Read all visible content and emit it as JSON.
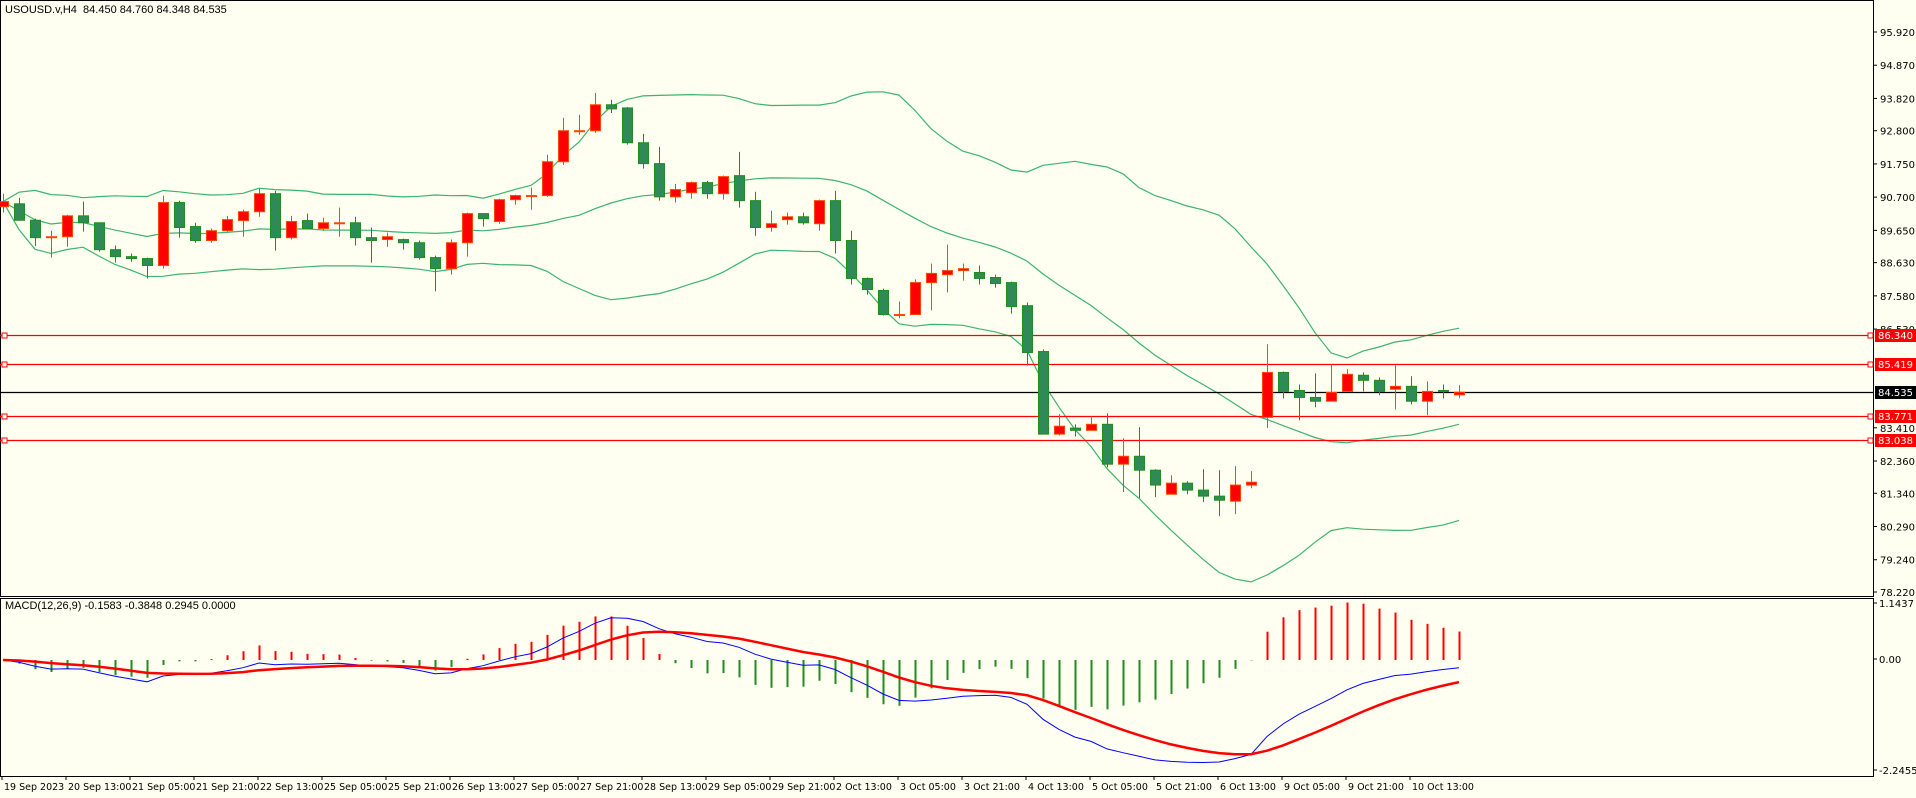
{
  "header": {
    "symbol_timeframe": "USOUSD.v,H4",
    "ohlc_readout": "84.450 84.760 84.348 84.535"
  },
  "indicator": {
    "label": "MACD(12,26,9)",
    "values_readout": "-0.1583 -0.3848 0.2945 0.0000"
  },
  "colors": {
    "background": "#FEFFF0",
    "bull_candle": "#FF0000",
    "bull_border": "#FF4500",
    "bear_candle": "#2E8B57",
    "bear_border": "#228B22",
    "bollinger": "#3CB371",
    "level_line": "#FF0000",
    "bid_line": "#000000",
    "macd_line": "#0000FF",
    "signal_line": "#FF0000"
  },
  "chart_data": {
    "type": "candlestick",
    "timeframe": "H4",
    "bollinger": {
      "period": 20,
      "deviation": 2
    },
    "macd": {
      "fast": 12,
      "slow": 26,
      "signal": 9,
      "ylim": [
        -2.2455,
        1.1437
      ],
      "tick_labels": [
        "1.1437",
        "0.00",
        "-2.2455"
      ]
    },
    "ylim": [
      78.22,
      95.92
    ],
    "y_tick_labels": [
      "95.920",
      "94.870",
      "93.820",
      "92.800",
      "91.750",
      "90.700",
      "89.650",
      "88.630",
      "87.580",
      "86.530",
      "83.410",
      "82.360",
      "81.340",
      "80.290",
      "79.240",
      "78.220"
    ],
    "x_tick_labels": [
      "19 Sep 2023",
      "20 Sep 13:00",
      "21 Sep 05:00",
      "21 Sep 21:00",
      "22 Sep 13:00",
      "25 Sep 05:00",
      "25 Sep 21:00",
      "26 Sep 13:00",
      "27 Sep 05:00",
      "27 Sep 21:00",
      "28 Sep 13:00",
      "29 Sep 05:00",
      "29 Sep 21:00",
      "2 Oct 13:00",
      "3 Oct 05:00",
      "3 Oct 21:00",
      "4 Oct 13:00",
      "5 Oct 05:00",
      "5 Oct 21:00",
      "6 Oct 13:00",
      "9 Oct 05:00",
      "9 Oct 21:00",
      "10 Oct 13:00"
    ],
    "levels": [
      {
        "price": 86.34,
        "label": "86.340",
        "kind": "level"
      },
      {
        "price": 85.419,
        "label": "85.419",
        "kind": "level"
      },
      {
        "price": 84.535,
        "label": "84.535",
        "kind": "bid"
      },
      {
        "price": 83.771,
        "label": "83.771",
        "kind": "level"
      },
      {
        "price": 83.038,
        "label": "83.038",
        "kind": "level"
      }
    ],
    "ohlc": [
      [
        90.4,
        90.81,
        90.21,
        90.56
      ],
      [
        90.49,
        90.68,
        89.97,
        89.97
      ],
      [
        89.97,
        90.02,
        89.16,
        89.42
      ],
      [
        89.45,
        89.64,
        88.79,
        89.45
      ],
      [
        89.45,
        90.14,
        89.13,
        90.11
      ],
      [
        90.11,
        90.56,
        89.61,
        89.89
      ],
      [
        89.89,
        89.89,
        88.98,
        89.04
      ],
      [
        89.04,
        89.17,
        88.63,
        88.82
      ],
      [
        88.82,
        88.92,
        88.66,
        88.76
      ],
      [
        88.76,
        88.79,
        88.13,
        88.54
      ],
      [
        88.54,
        90.75,
        88.44,
        90.53
      ],
      [
        90.53,
        90.59,
        89.42,
        89.74
      ],
      [
        89.77,
        89.89,
        89.26,
        89.33
      ],
      [
        89.33,
        89.71,
        89.26,
        89.64
      ],
      [
        89.64,
        90.11,
        89.61,
        89.99
      ],
      [
        89.96,
        90.3,
        89.45,
        90.24
      ],
      [
        90.24,
        90.97,
        90.08,
        90.81
      ],
      [
        90.81,
        90.9,
        89.01,
        89.42
      ],
      [
        89.42,
        90.11,
        89.36,
        89.93
      ],
      [
        89.96,
        90.18,
        89.71,
        89.71
      ],
      [
        89.71,
        90.05,
        89.64,
        89.89
      ],
      [
        89.89,
        90.37,
        89.45,
        89.89
      ],
      [
        89.89,
        90.08,
        89.17,
        89.42
      ],
      [
        89.42,
        89.74,
        88.63,
        89.33
      ],
      [
        89.36,
        89.58,
        89.13,
        89.45
      ],
      [
        89.36,
        89.39,
        89.04,
        89.26
      ],
      [
        89.26,
        89.33,
        88.73,
        88.79
      ],
      [
        88.79,
        88.85,
        87.72,
        88.44
      ],
      [
        88.44,
        89.36,
        88.25,
        89.26
      ],
      [
        89.26,
        90.21,
        88.82,
        90.18
      ],
      [
        90.18,
        90.18,
        89.77,
        90.02
      ],
      [
        89.93,
        90.65,
        89.86,
        90.62
      ],
      [
        90.62,
        90.78,
        90.46,
        90.75
      ],
      [
        90.75,
        91.0,
        90.3,
        90.75
      ],
      [
        90.75,
        92.04,
        90.71,
        91.82
      ],
      [
        91.82,
        93.21,
        91.72,
        92.8
      ],
      [
        92.8,
        93.3,
        92.67,
        92.8
      ],
      [
        92.8,
        93.99,
        92.73,
        93.62
      ],
      [
        93.62,
        93.78,
        93.36,
        93.49
      ],
      [
        93.52,
        93.55,
        92.36,
        92.42
      ],
      [
        92.42,
        92.7,
        91.6,
        91.76
      ],
      [
        91.76,
        92.29,
        90.59,
        90.71
      ],
      [
        90.71,
        91.12,
        90.53,
        90.94
      ],
      [
        90.84,
        91.19,
        90.65,
        91.16
      ],
      [
        91.16,
        91.22,
        90.65,
        90.81
      ],
      [
        90.81,
        91.38,
        90.62,
        91.35
      ],
      [
        91.38,
        92.13,
        90.37,
        90.59
      ],
      [
        90.59,
        90.87,
        89.48,
        89.74
      ],
      [
        89.74,
        90.27,
        89.61,
        89.86
      ],
      [
        89.99,
        90.21,
        89.83,
        90.08
      ],
      [
        90.08,
        90.21,
        89.83,
        89.89
      ],
      [
        89.86,
        90.62,
        89.64,
        90.59
      ],
      [
        90.59,
        90.9,
        88.92,
        89.33
      ],
      [
        89.33,
        89.64,
        87.94,
        88.13
      ],
      [
        88.13,
        88.16,
        87.62,
        87.78
      ],
      [
        87.75,
        87.81,
        86.96,
        86.99
      ],
      [
        86.99,
        87.4,
        86.87,
        86.99
      ],
      [
        86.99,
        88.1,
        86.99,
        88.0
      ],
      [
        88.0,
        88.6,
        87.12,
        88.29
      ],
      [
        88.25,
        89.2,
        87.69,
        88.38
      ],
      [
        88.38,
        88.6,
        88.06,
        88.44
      ],
      [
        88.32,
        88.54,
        87.94,
        88.13
      ],
      [
        88.16,
        88.25,
        87.84,
        87.97
      ],
      [
        88.0,
        88.03,
        87.02,
        87.24
      ],
      [
        87.27,
        87.37,
        85.38,
        85.79
      ],
      [
        85.82,
        85.89,
        83.21,
        83.21
      ],
      [
        83.21,
        83.84,
        83.17,
        83.46
      ],
      [
        83.4,
        83.52,
        83.14,
        83.33
      ],
      [
        83.33,
        83.74,
        83.33,
        83.52
      ],
      [
        83.52,
        83.87,
        82.16,
        82.26
      ],
      [
        82.26,
        83.08,
        81.38,
        82.51
      ],
      [
        82.51,
        83.43,
        81.19,
        82.07
      ],
      [
        82.07,
        82.1,
        81.22,
        81.6
      ],
      [
        81.31,
        81.91,
        81.31,
        81.66
      ],
      [
        81.66,
        81.72,
        81.31,
        81.44
      ],
      [
        81.44,
        82.1,
        81.06,
        81.25
      ],
      [
        81.25,
        82.07,
        80.62,
        81.12
      ],
      [
        81.09,
        82.2,
        80.68,
        81.6
      ],
      [
        81.6,
        82.04,
        81.5,
        81.69
      ],
      [
        83.74,
        86.05,
        83.4,
        85.16
      ],
      [
        85.16,
        85.19,
        84.34,
        84.56
      ],
      [
        84.59,
        84.78,
        83.65,
        84.37
      ],
      [
        84.37,
        85.13,
        84.06,
        84.25
      ],
      [
        84.25,
        85.41,
        84.25,
        84.53
      ],
      [
        84.56,
        85.26,
        84.56,
        85.1
      ],
      [
        85.07,
        85.16,
        84.56,
        84.91
      ],
      [
        84.91,
        85.0,
        84.44,
        84.56
      ],
      [
        84.63,
        85.38,
        83.99,
        84.72
      ],
      [
        84.72,
        85.04,
        84.15,
        84.25
      ],
      [
        84.25,
        84.88,
        83.81,
        84.56
      ],
      [
        84.59,
        84.78,
        84.34,
        84.56
      ],
      [
        84.45,
        84.76,
        84.348,
        84.535
      ]
    ]
  }
}
